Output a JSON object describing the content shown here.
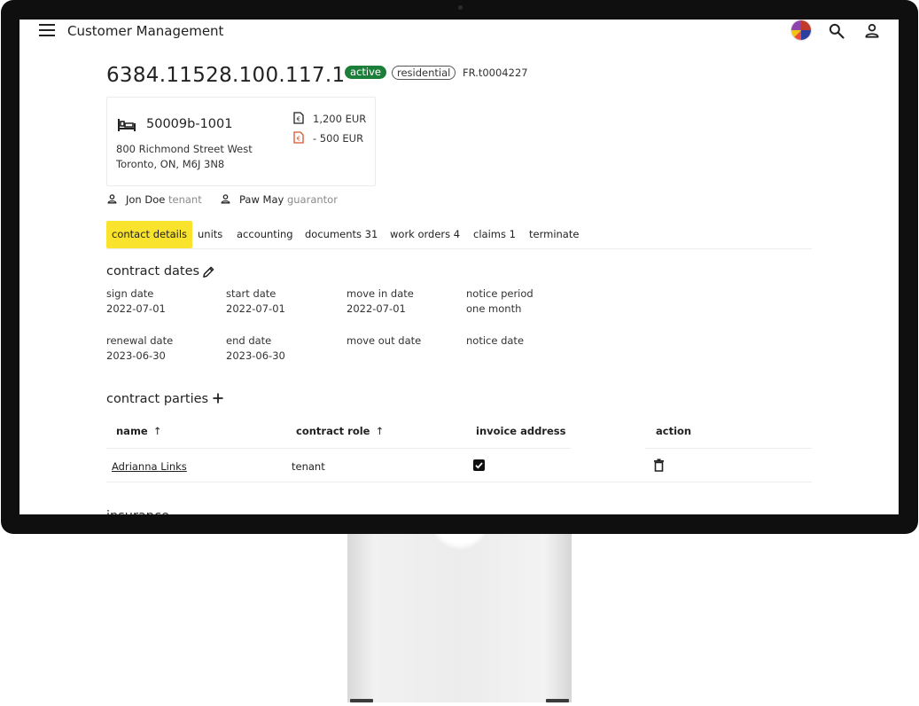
{
  "app": {
    "title": "Customer Management",
    "menu_icon": "menu-icon",
    "flag_icon": "language-flag-icon",
    "search_icon": "search-icon",
    "user_icon": "account-icon"
  },
  "contract": {
    "id": "6384.11528.100.117.1",
    "status": "active",
    "type": "residential",
    "reference": "FR.t0004227",
    "status_color": "#1b7f3a"
  },
  "unit": {
    "number": "50009b-1001",
    "address_line1": "800 Richmond Street West",
    "address_line2": "Toronto, ON, M6J 3N8",
    "amount_positive": "1,200 EUR",
    "amount_negative": "- 500 EUR"
  },
  "parties_summary": [
    {
      "name": "Jon Doe",
      "role": "tenant"
    },
    {
      "name": "Paw May",
      "role": "guarantor"
    }
  ],
  "tabs": [
    {
      "label": "contact details",
      "active": true
    },
    {
      "label": "units",
      "active": false
    },
    {
      "label": "accounting",
      "active": false
    },
    {
      "label": "documents 31",
      "active": false
    },
    {
      "label": "work orders 4",
      "active": false
    },
    {
      "label": "claims 1",
      "active": false
    },
    {
      "label": "terminate",
      "active": false
    }
  ],
  "contract_dates": {
    "title": "contract dates",
    "fields": [
      {
        "label": "sign date",
        "value": "2022-07-01"
      },
      {
        "label": "start date",
        "value": "2022-07-01"
      },
      {
        "label": "move in date",
        "value": "2022-07-01"
      },
      {
        "label": "notice period",
        "value": "one month"
      },
      {
        "label": "renewal date",
        "value": "2023-06-30"
      },
      {
        "label": "end date",
        "value": "2023-06-30"
      },
      {
        "label": "move out date",
        "value": ""
      },
      {
        "label": "notice date",
        "value": ""
      }
    ]
  },
  "contract_parties": {
    "title": "contract parties",
    "columns": [
      {
        "label": "name",
        "sort": "↑"
      },
      {
        "label": "contract role",
        "sort": "↑"
      },
      {
        "label": "invoice address",
        "sort": ""
      },
      {
        "label": "action",
        "sort": ""
      }
    ],
    "rows": [
      {
        "name": "Adrianna Links",
        "role": "tenant",
        "invoice_address": true
      }
    ]
  },
  "accent_color": "#f9e32c",
  "next_section_partial": "insurance"
}
